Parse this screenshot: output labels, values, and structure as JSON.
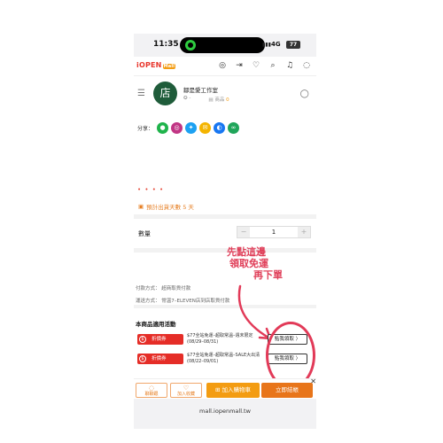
{
  "status": {
    "time": "11:35",
    "network": "4G",
    "battery": "77"
  },
  "nav": {
    "logo": "iOPEN",
    "logo_sub": "Mall"
  },
  "shop": {
    "avatar_text": "店",
    "name": "鄒是愛工作室",
    "products_label": "商品",
    "products_count": "0",
    "rating_value": "-"
  },
  "share": {
    "label": "分享："
  },
  "product": {
    "price_dots": "• • • •",
    "ship_days_text": "預計出貨天數 5 天"
  },
  "quantity": {
    "label": "數量",
    "value": "1",
    "minus": "−",
    "plus": "+"
  },
  "annotation": {
    "line1": "先點這邊",
    "line2": "領取免運",
    "line3": "再下單"
  },
  "payment": {
    "pay_text": "付款方式：  超商取貨付款",
    "ship_text": "運送方式：  常溫7–ELEVEN店到店取貨付款"
  },
  "promo": {
    "title": "本商品適用活動",
    "items": [
      {
        "badge": "折價券",
        "desc": "$77全站免運–超取常溫–週末限定 (08/29–08/31)",
        "button": "點我領取 〉"
      },
      {
        "badge": "折價券",
        "desc": "$77全站免運–超取常溫–SALE大出清 (08/22–09/01)",
        "button": "點我領取 〉"
      }
    ]
  },
  "bottom": {
    "chat_label": "聊聊跟",
    "fav_label": "加入收藏",
    "cart_label": "加入購物車",
    "buy_label": "立即結帳",
    "close": "✕"
  },
  "browser": {
    "url": "mall.iopenmall.tw"
  },
  "colors": {
    "brand_red": "#e52d27",
    "orange": "#f39c12",
    "annotation_pink": "#e23a58"
  }
}
